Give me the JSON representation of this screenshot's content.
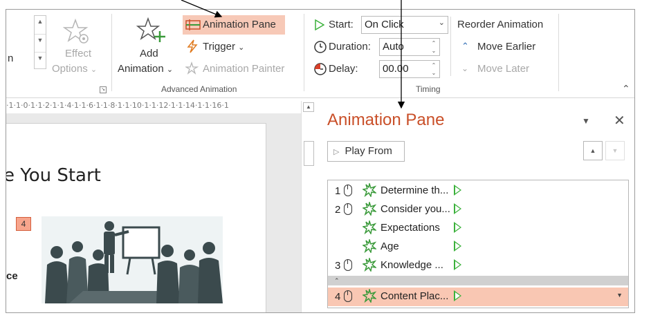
{
  "ribbon": {
    "effect_options_label_1": "Effect",
    "effect_options_label_2": "Options",
    "add_animation_label_1": "Add",
    "add_animation_label_2": "Animation",
    "animation_pane_label": "Animation Pane",
    "trigger_label": "Trigger",
    "animation_painter_label": "Animation Painter",
    "advanced_group_label": "Advanced Animation",
    "start_label": "Start:",
    "start_value": "On Click",
    "duration_label": "Duration:",
    "duration_value": "Auto",
    "delay_label": "Delay:",
    "delay_value": "00.00",
    "timing_group_label": "Timing",
    "reorder_label": "Reorder Animation",
    "move_earlier_label": "Move Earlier",
    "move_later_label": "Move Later",
    "left_partial_letter": "n",
    "caret_down": "⌄"
  },
  "ruler": {
    "text": "·1·1·0·1·1·2·1·1·4·1·1·6·1·1·8·1·1·10·1·1·12·1·1·14·1·1·16·1"
  },
  "slide": {
    "title": "e You Start",
    "badge": "4",
    "partial_text": "ce"
  },
  "pane": {
    "title": "Animation Pane",
    "play_from_label": "Play From",
    "items": [
      {
        "num": "1",
        "label": "Determine th..."
      },
      {
        "num": "2",
        "label": "Consider you..."
      },
      {
        "num": "",
        "label": "Expectations"
      },
      {
        "num": "",
        "label": "Age"
      },
      {
        "num": "3",
        "label": "Knowledge ..."
      },
      {
        "num": "4",
        "label": "Content Plac..."
      }
    ],
    "collapse_glyph": "⌃"
  },
  "colors": {
    "accent": "#c94f28",
    "highlight": "#f9c7b3",
    "green_play": "#3bb13b",
    "star_green": "#3a9a3a"
  }
}
